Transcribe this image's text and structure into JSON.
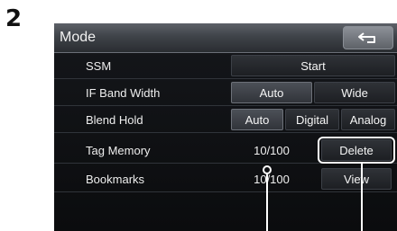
{
  "step_number": "2",
  "screen": {
    "title": "Mode",
    "back_icon": "return-arrow-icon",
    "rows": [
      {
        "label": "SSM",
        "buttons": [
          "Start"
        ]
      },
      {
        "label": "IF Band Width",
        "buttons": [
          "Auto",
          "Wide"
        ],
        "selected": "Auto"
      },
      {
        "label": "Blend Hold",
        "buttons": [
          "Auto",
          "Digital",
          "Analog"
        ],
        "selected": "Auto"
      },
      {
        "label": "Tag Memory",
        "value": "10/100",
        "buttons": [
          "Delete"
        ]
      },
      {
        "label": "Bookmarks",
        "value": "10/100",
        "buttons": [
          "View"
        ]
      }
    ]
  },
  "colors": {
    "screen_bg": "#101215",
    "active_button": "#45494f",
    "callout": "#ffffff"
  }
}
